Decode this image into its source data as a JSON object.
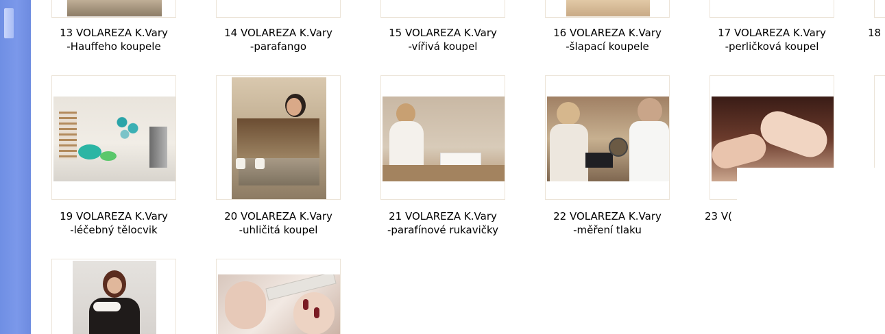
{
  "items": [
    {
      "line1": "13 VOLAREZA K.Vary",
      "line2": "-Hauffeho koupele"
    },
    {
      "line1": "14 VOLAREZA K.Vary",
      "line2": "-parafango"
    },
    {
      "line1": "15 VOLAREZA K.Vary",
      "line2": "-vířivá koupel"
    },
    {
      "line1": "16 VOLAREZA K.Vary",
      "line2": "-šlapací koupele"
    },
    {
      "line1": "17 VOLAREZA K.Vary",
      "line2": "-perličková koupel"
    },
    {
      "line1": "18",
      "line2": ""
    },
    {
      "line1": "19 VOLAREZA K.Vary",
      "line2": "-léčebný tělocvik"
    },
    {
      "line1": "20 VOLAREZA K.Vary",
      "line2": "-uhličitá koupel"
    },
    {
      "line1": "21 VOLAREZA K.Vary",
      "line2": "-parafínové rukavičky"
    },
    {
      "line1": "22 VOLAREZA K.Vary",
      "line2": "-měření tlaku"
    },
    {
      "line1": "23 V(",
      "line2": ""
    }
  ]
}
